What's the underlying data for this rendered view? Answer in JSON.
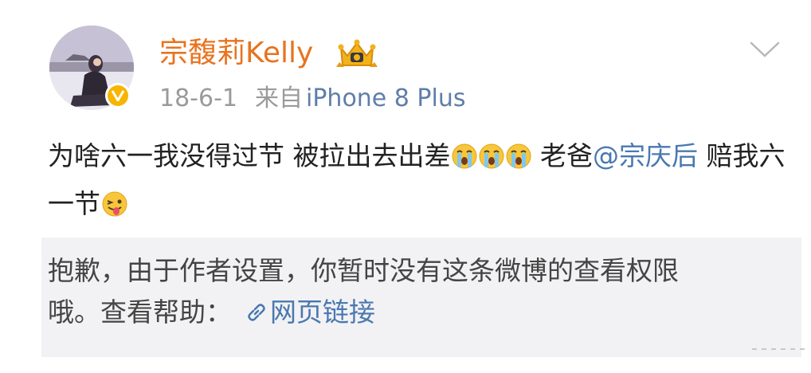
{
  "user": {
    "name": "宗馥莉Kelly",
    "verified_icon": "verified-v-icon",
    "member_icon": "crown-member-icon",
    "accent_color": "#e8731e"
  },
  "meta": {
    "date": "18-6-1",
    "from_label": "来自",
    "device": "iPhone 8 Plus"
  },
  "post": {
    "line1_text": "为啥六一我没得过节 被拉出去出差",
    "line1_after_emoji": "老爸",
    "mention": "@宗庆后",
    "line2_text": "赔我六一节",
    "emojis": [
      "crying-emoji",
      "crying-emoji",
      "crying-emoji",
      "tongue-wink-emoji"
    ]
  },
  "notice": {
    "text_line1": "抱歉，由于作者设置，你暂时没有这条微博的查看权限",
    "text_line2": "哦。查看帮助：",
    "link_label": "网页链接",
    "link_icon": "link-icon"
  },
  "colors": {
    "link": "#4a78b0",
    "meta_gray": "#9a9a9a",
    "notice_bg": "#f2f2f4"
  }
}
